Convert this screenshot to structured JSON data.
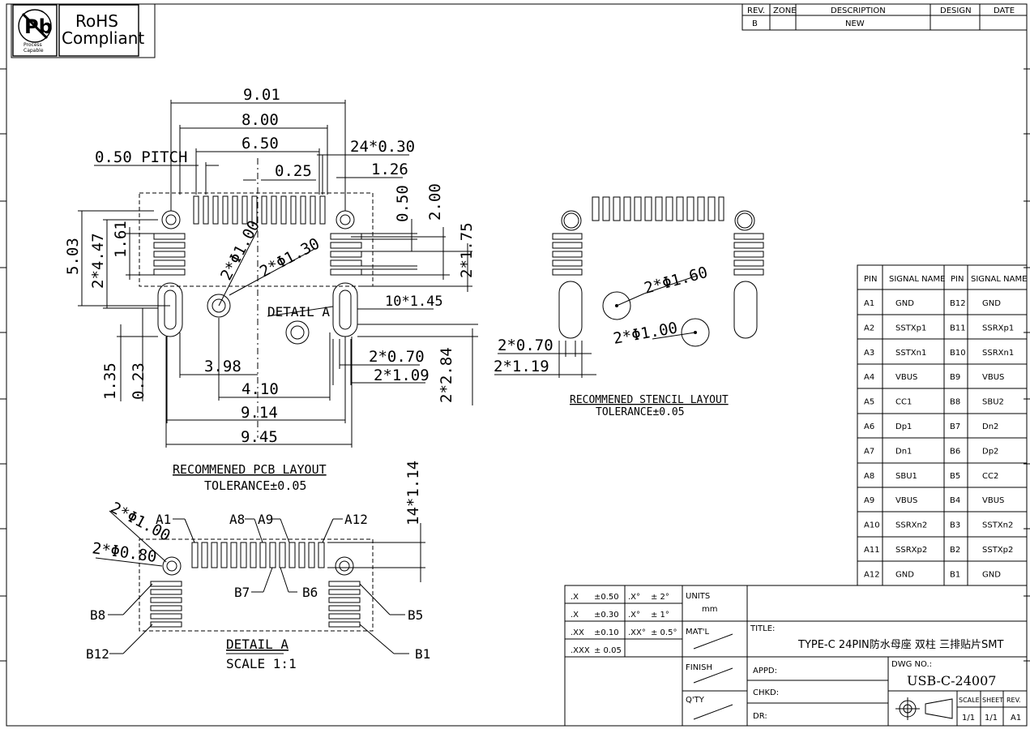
{
  "logos": {
    "pb_caption": "Process Capable",
    "rohs_line1": "RoHS",
    "rohs_line2": "Compliant"
  },
  "revision_block": {
    "headers": [
      "REV.",
      "ZONE",
      "DESCRIPTION",
      "DESIGN",
      "DATE"
    ],
    "row": [
      "B",
      "",
      "NEW",
      "",
      ""
    ]
  },
  "pcb_layout": {
    "dims": {
      "w901": "9.01",
      "w800": "8.00",
      "w650": "6.50",
      "pitch": "0.50 PITCH",
      "pads": "24*0.30",
      "w025": "0.25",
      "w126": "1.26",
      "h050": "0.50",
      "h200": "2.00",
      "h503": "5.03",
      "h447": "2*4.47",
      "h161": "1.61",
      "d100": "2*Φ1.00",
      "d130": "2*Φ1.30",
      "h175": "2*1.75",
      "detail": "DETAIL A",
      "slot145": "10*1.45",
      "w070": "2*0.70",
      "w109": "2*1.09",
      "h284": "2*2.84",
      "w398": "3.98",
      "w410": "4.10",
      "h135": "1.35",
      "h023": "0.23",
      "w914": "9.14",
      "w945": "9.45"
    },
    "title": "RECOMMENED PCB LAYOUT",
    "tolerance": "TOLERANCE±0.05"
  },
  "stencil_layout": {
    "dims": {
      "d160": "2*Φ1.60",
      "d100": "2*Φ1.00",
      "w070": "2*0.70",
      "w119": "2*1.19"
    },
    "title": "RECOMMENED STENCIL LAYOUT",
    "tolerance": "TOLERANCE±0.05"
  },
  "detail_a": {
    "labels": {
      "d100": "2*Φ1.00",
      "d080": "2*Φ0.80",
      "a1": "A1",
      "a8": "A8",
      "a9": "A9",
      "a12": "A12",
      "h114": "14*1.14",
      "b7": "B7",
      "b6": "B6",
      "b8": "B8",
      "b5": "B5",
      "b12": "B12",
      "b1": "B1"
    },
    "title": "DETAIL A",
    "scale": "SCALE 1:1"
  },
  "pin_table": {
    "headers": [
      "PIN",
      "SIGNAL NAME",
      "PIN",
      "SIGNAL NAME"
    ],
    "rows": [
      [
        "A1",
        "GND",
        "B12",
        "GND"
      ],
      [
        "A2",
        "SSTXp1",
        "B11",
        "SSRXp1"
      ],
      [
        "A3",
        "SSTXn1",
        "B10",
        "SSRXn1"
      ],
      [
        "A4",
        "VBUS",
        "B9",
        "VBUS"
      ],
      [
        "A5",
        "CC1",
        "B8",
        "SBU2"
      ],
      [
        "A6",
        "Dp1",
        "B7",
        "Dn2"
      ],
      [
        "A7",
        "Dn1",
        "B6",
        "Dp2"
      ],
      [
        "A8",
        "SBU1",
        "B5",
        "CC2"
      ],
      [
        "A9",
        "VBUS",
        "B4",
        "VBUS"
      ],
      [
        "A10",
        "SSRXn2",
        "B3",
        "SSTXn2"
      ],
      [
        "A11",
        "SSRXp2",
        "B2",
        "SSTXp2"
      ],
      [
        "A12",
        "GND",
        "B1",
        "GND"
      ]
    ]
  },
  "tolerance_block": {
    "rows": [
      [
        ".X",
        "±0.50",
        ".X°",
        "± 2°"
      ],
      [
        ".X",
        "±0.30",
        ".X°",
        "± 1°"
      ],
      [
        ".XX",
        "±0.10",
        ".XX°",
        "± 0.5°"
      ],
      [
        ".XXX",
        "± 0.05",
        "",
        ""
      ]
    ]
  },
  "title_block": {
    "units_label": "UNITS",
    "units_value": "mm",
    "matl_label": "MAT'L",
    "finish_label": "FINISH",
    "qty_label": "Q'TY",
    "title_label": "TITLE:",
    "title_value": "TYPE-C 24PIN防水母座 双柱 三排贴片SMT",
    "appd_label": "APPD:",
    "chkd_label": "CHKD:",
    "dr_label": "DR:",
    "dwg_label": "DWG NO.:",
    "dwg_value": "USB-C-24007",
    "scale_label": "SCALE",
    "sheet_label": "SHEET",
    "rev_label": "REV.",
    "scale_value": "1/1",
    "sheet_value": "1/1",
    "rev_value": "A1"
  }
}
